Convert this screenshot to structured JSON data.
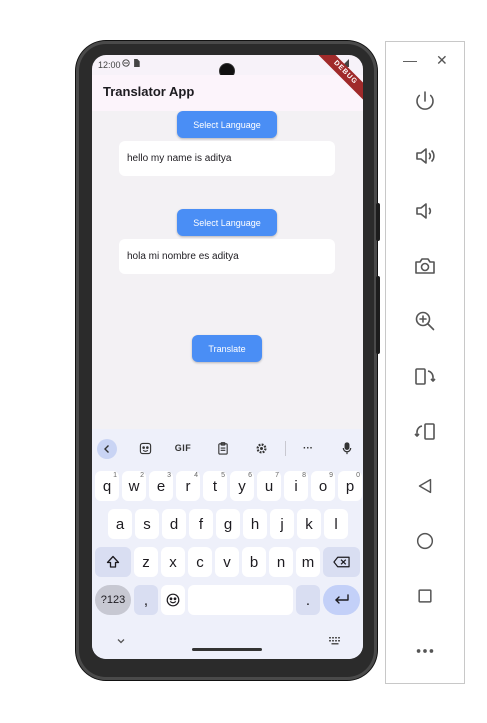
{
  "status_bar": {
    "time": "12:00"
  },
  "debug_banner": "DEBUG",
  "app_bar": {
    "title": "Translator App"
  },
  "source": {
    "button_label": "Select Language",
    "text": "hello my name is aditya"
  },
  "target": {
    "button_label": "Select Language",
    "text": "hola mi nombre es aditya"
  },
  "translate_button": "Translate",
  "keyboard": {
    "toolbar": {
      "gif_label": "GIF",
      "more_label": "···"
    },
    "row1": [
      {
        "k": "q",
        "n": "1"
      },
      {
        "k": "w",
        "n": "2"
      },
      {
        "k": "e",
        "n": "3"
      },
      {
        "k": "r",
        "n": "4"
      },
      {
        "k": "t",
        "n": "5"
      },
      {
        "k": "y",
        "n": "6"
      },
      {
        "k": "u",
        "n": "7"
      },
      {
        "k": "i",
        "n": "8"
      },
      {
        "k": "o",
        "n": "9"
      },
      {
        "k": "p",
        "n": "0"
      }
    ],
    "row2": [
      "a",
      "s",
      "d",
      "f",
      "g",
      "h",
      "j",
      "k",
      "l"
    ],
    "row3": [
      "z",
      "x",
      "c",
      "v",
      "b",
      "n",
      "m"
    ],
    "sym_label": "?123",
    "comma": ",",
    "period": "."
  },
  "colors": {
    "accent": "#4a8ef5",
    "app_bar_bg": "#fcf4fb",
    "content_bg": "#f3f1f4",
    "keyboard_bg": "#eef0fa"
  }
}
